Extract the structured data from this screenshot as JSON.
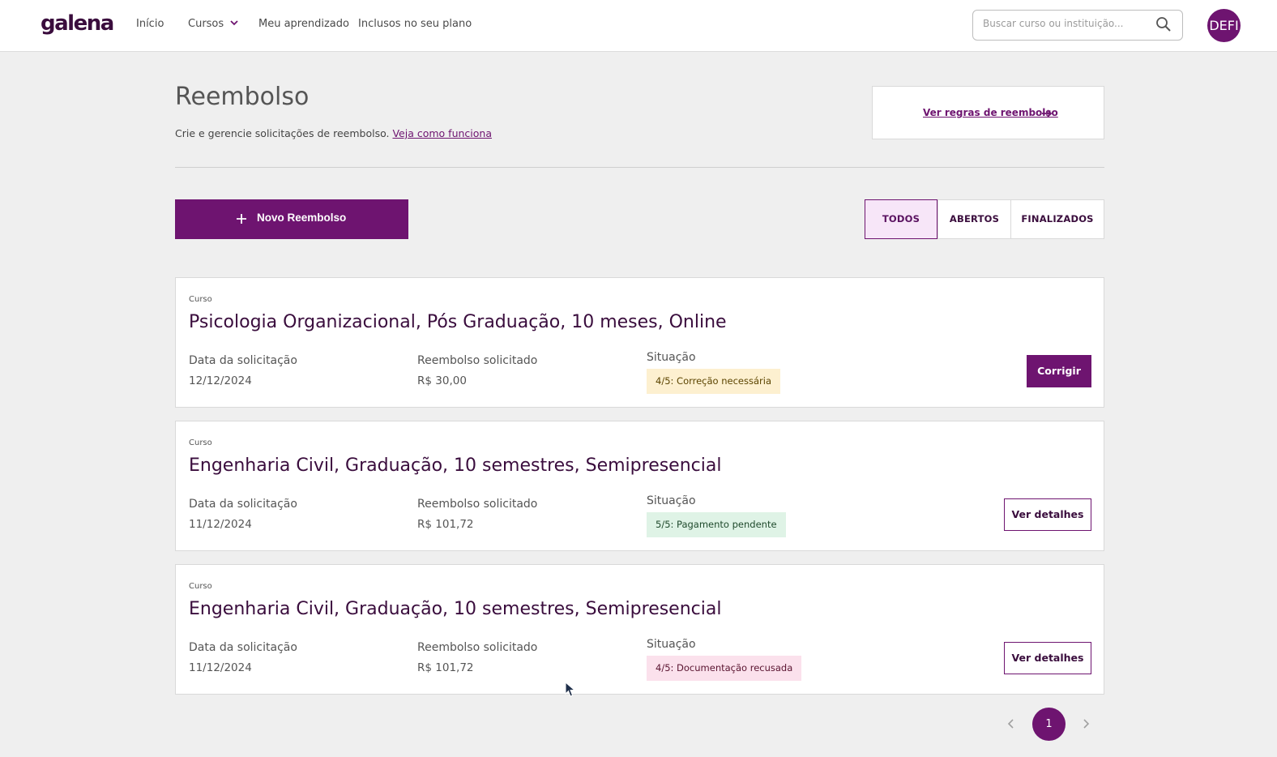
{
  "header": {
    "logo": "galena",
    "nav": [
      {
        "label": "Início"
      },
      {
        "label": "Cursos"
      },
      {
        "label": "Meu aprendizado"
      },
      {
        "label": "Inclusos no seu plano"
      }
    ],
    "search_placeholder": "Buscar curso ou instituição...",
    "avatar_initials": "DEFI"
  },
  "page": {
    "title": "Reembolso",
    "subtitle": "Crie e gerencie solicitações de reembolso.",
    "subtitle_link": "Veja como funciona",
    "rules_link": "Ver regras de reembolso"
  },
  "actions": {
    "new_button": "Novo Reembolso",
    "filters": [
      {
        "label": "TODOS",
        "active": true
      },
      {
        "label": "ABERTOS",
        "active": false
      },
      {
        "label": "FINALIZADOS",
        "active": false
      }
    ]
  },
  "labels": {
    "course": "Curso",
    "request_date": "Data da solicitação",
    "requested_amount": "Reembolso solicitado",
    "status": "Situação"
  },
  "requests": [
    {
      "course": "Psicologia Organizacional, Pós Graduação, 10 meses, Online",
      "date": "12/12/2024",
      "amount": "R$ 30,00",
      "status": "4/5: Correção necessária",
      "status_color": "#fdf0d0",
      "action": "Corrigir"
    },
    {
      "course": "Engenharia Civil, Graduação, 10 semestres, Semipresencial",
      "date": "11/12/2024",
      "amount": "R$ 101,72",
      "status": "5/5: Pagamento pendente",
      "status_color": "#dff3e6",
      "action": "Ver detalhes"
    },
    {
      "course": "Engenharia Civil, Graduação, 10 semestres, Semipresencial",
      "date": "11/12/2024",
      "amount": "R$ 101,72",
      "status": "4/5: Documentação recusada",
      "status_color": "#fbe1ec",
      "action": "Ver detalhes"
    }
  ],
  "pagination": {
    "current": "1"
  },
  "colors": {
    "brand": "#6e1470",
    "brand_dark": "#3a0d3d"
  }
}
